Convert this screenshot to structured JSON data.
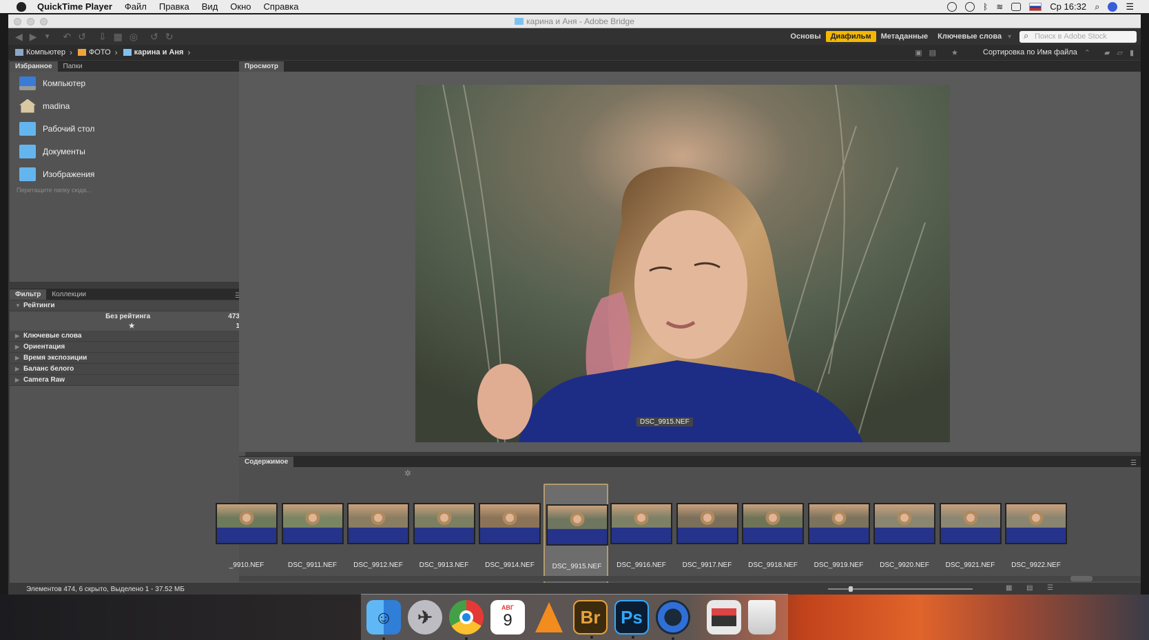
{
  "menubar": {
    "app_name": "QuickTime Player",
    "items": [
      "Файл",
      "Правка",
      "Вид",
      "Окно",
      "Справка"
    ],
    "clock": "Ср 16:32"
  },
  "window": {
    "title": "карина и Аня - Adobe Bridge"
  },
  "toolbar": {
    "workspaces": [
      "Основы",
      "Диафильм",
      "Метаданные",
      "Ключевые слова"
    ],
    "active_workspace": "Диафильм",
    "search_placeholder": "Поиск в Adobe Stock"
  },
  "pathbar": {
    "crumbs": [
      "Компьютер",
      "ФОТО",
      "карина и Аня"
    ],
    "sort_label": "Сортировка по Имя файла"
  },
  "favorites_panel": {
    "tabs": [
      "Избранное",
      "Папки"
    ],
    "items": [
      {
        "label": "Компьютер",
        "icon": "computer-icon"
      },
      {
        "label": "madina",
        "icon": "home-icon"
      },
      {
        "label": "Рабочий стол",
        "icon": "folder-icon"
      },
      {
        "label": "Документы",
        "icon": "folder-icon"
      },
      {
        "label": "Изображения",
        "icon": "folder-icon"
      }
    ],
    "drop_hint": "Перетащите папку сюда..."
  },
  "filter_panel": {
    "tabs": [
      "Фильтр",
      "Коллекции"
    ],
    "ratings_header": "Рейтинги",
    "rating_rows": [
      {
        "label": "Без рейтинга",
        "count": "473"
      },
      {
        "label": "★",
        "count": "1"
      }
    ],
    "sections": [
      "Ключевые слова",
      "Ориентация",
      "Время экспозиции",
      "Баланс белого",
      "Camera Raw"
    ]
  },
  "preview_panel": {
    "tab": "Просмотр",
    "filename": "DSC_9915.NEF"
  },
  "content_panel": {
    "tab": "Содержимое",
    "thumbnails": [
      {
        "label": "_9910.NEF",
        "selected": false
      },
      {
        "label": "DSC_9911.NEF",
        "selected": false
      },
      {
        "label": "DSC_9912.NEF",
        "selected": false
      },
      {
        "label": "DSC_9913.NEF",
        "selected": false
      },
      {
        "label": "DSC_9914.NEF",
        "selected": false
      },
      {
        "label": "DSC_9915.NEF",
        "selected": true
      },
      {
        "label": "DSC_9916.NEF",
        "selected": false
      },
      {
        "label": "DSC_9917.NEF",
        "selected": false
      },
      {
        "label": "DSC_9918.NEF",
        "selected": false
      },
      {
        "label": "DSC_9919.NEF",
        "selected": false
      },
      {
        "label": "DSC_9920.NEF",
        "selected": false
      },
      {
        "label": "DSC_9921.NEF",
        "selected": false
      },
      {
        "label": "DSC_9922.NEF",
        "selected": false
      }
    ]
  },
  "statusbar": {
    "text": "Элементов 474, 6 скрыто, Выделено 1 - 37.52 МБ"
  },
  "dock": {
    "apps": [
      "Finder",
      "Launchpad",
      "Chrome",
      "Calendar",
      "VLC",
      "Bridge",
      "Photoshop",
      "QuickTime",
      "Preview",
      "Trash"
    ],
    "calendar_day": "9",
    "calendar_month": "АВГ",
    "bridge_text": "Br",
    "photoshop_text": "Ps"
  },
  "colors": {
    "accent": "#f5b700",
    "panel": "#535353",
    "selected_border": "#b49a70"
  }
}
